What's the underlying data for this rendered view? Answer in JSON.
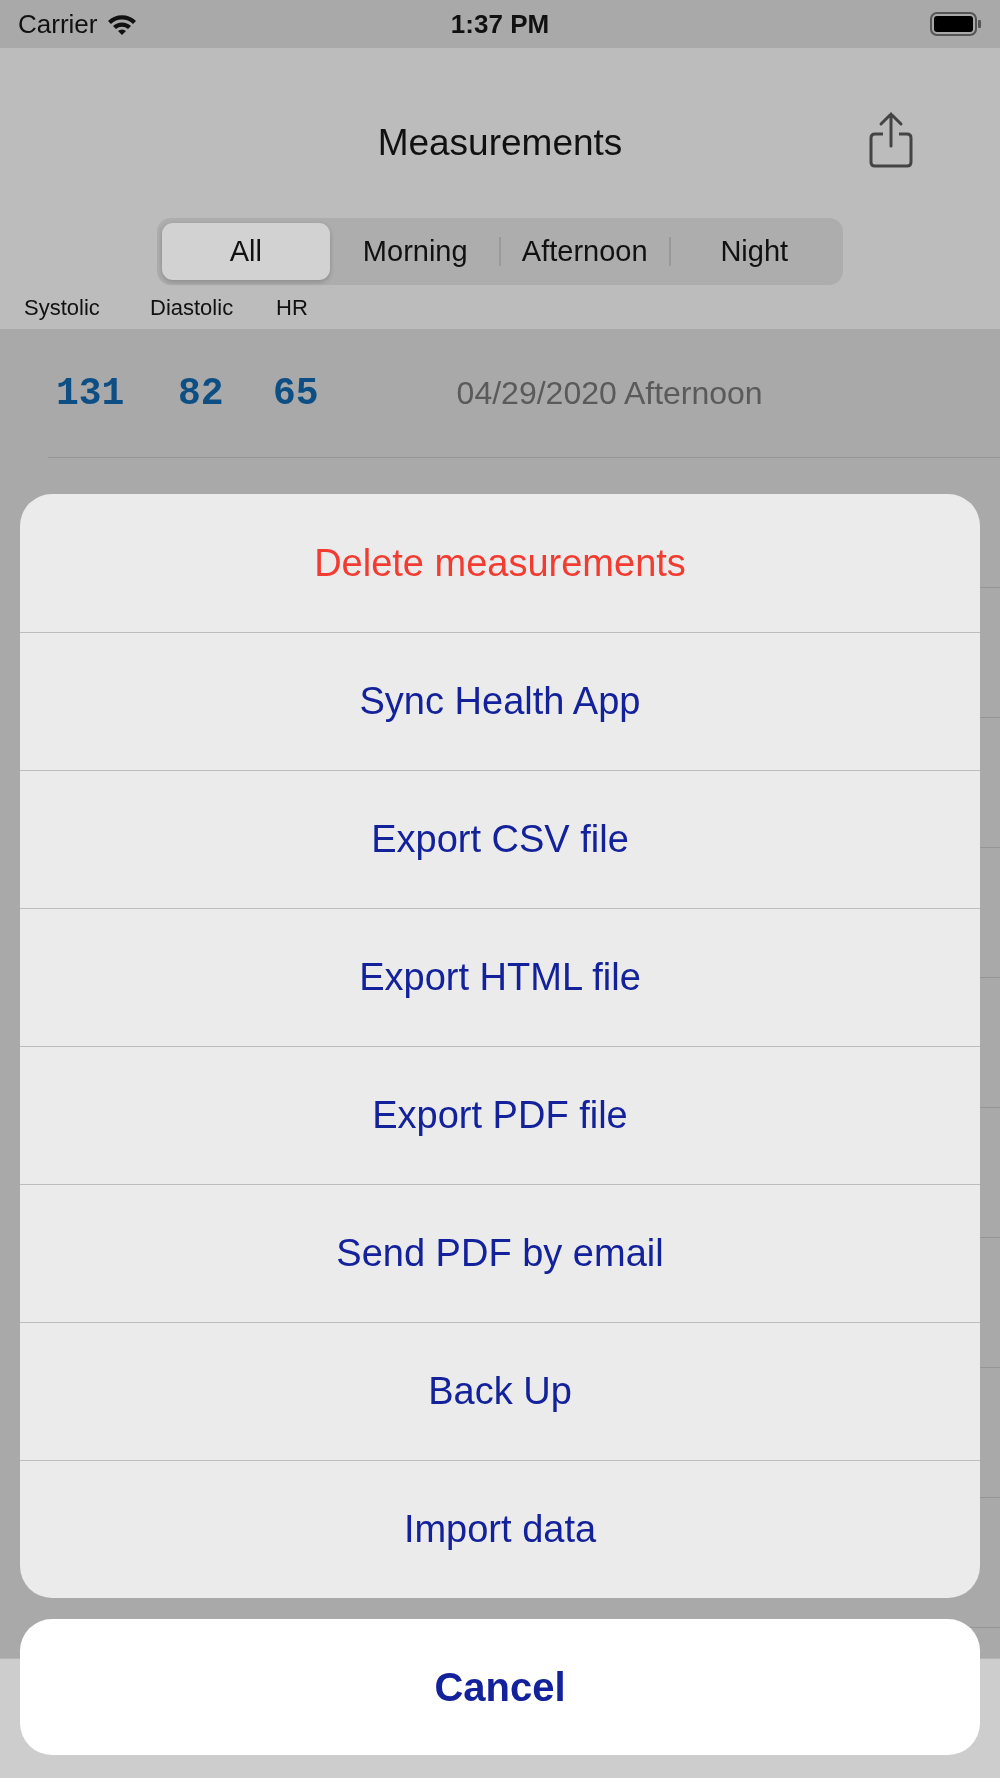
{
  "status_bar": {
    "carrier": "Carrier",
    "time": "1:37 PM"
  },
  "nav": {
    "title": "Measurements"
  },
  "segments": [
    {
      "label": "All",
      "selected": true
    },
    {
      "label": "Morning",
      "selected": false
    },
    {
      "label": "Afternoon",
      "selected": false
    },
    {
      "label": "Night",
      "selected": false
    }
  ],
  "columns": [
    "Systolic",
    "Diastolic",
    "HR"
  ],
  "rows": [
    {
      "systolic": "131",
      "diastolic": "82",
      "hr": "65",
      "date": "04/29/2020 Afternoon"
    }
  ],
  "action_sheet": {
    "actions": [
      {
        "label": "Delete measurements",
        "kind": "destructive"
      },
      {
        "label": "Sync Health App",
        "kind": "default"
      },
      {
        "label": "Export CSV file",
        "kind": "default"
      },
      {
        "label": "Export HTML file",
        "kind": "default"
      },
      {
        "label": "Export PDF file",
        "kind": "default"
      },
      {
        "label": "Send PDF by email",
        "kind": "default"
      },
      {
        "label": "Back Up",
        "kind": "default"
      },
      {
        "label": "Import data",
        "kind": "default"
      }
    ],
    "cancel": "Cancel"
  }
}
